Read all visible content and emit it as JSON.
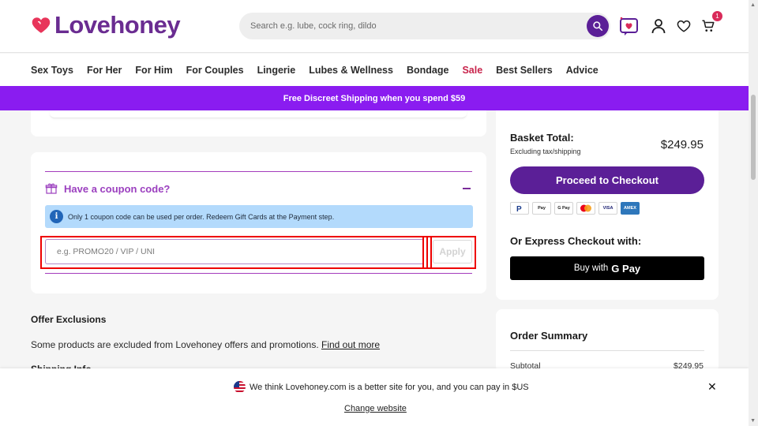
{
  "header": {
    "logo_text": "Lovehoney",
    "search_placeholder": "Search e.g. lube, cock ring, dildo",
    "cart_count": "1"
  },
  "nav": {
    "items": [
      "Sex Toys",
      "For Her",
      "For Him",
      "For Couples",
      "Lingerie",
      "Lubes & Wellness",
      "Bondage",
      "Sale",
      "Best Sellers",
      "Advice"
    ]
  },
  "promo": {
    "text": "Free Discreet Shipping when you spend $59"
  },
  "coupon": {
    "title": "Have a coupon code?",
    "info": "Only 1 coupon code can be used per order. Redeem Gift Cards at the Payment step.",
    "input_placeholder": "e.g. PROMO20 / VIP / UNI",
    "apply_label": "Apply"
  },
  "offers": {
    "title": "Offer Exclusions",
    "text": "Some products are excluded from Lovehoney offers and promotions. ",
    "link": "Find out more",
    "next_heading": "Shipping Info"
  },
  "basket": {
    "title": "Basket Total:",
    "subtitle": "Excluding tax/shipping",
    "total": "$249.95",
    "checkout_label": "Proceed to Checkout",
    "payment_methods": [
      "PayPal",
      "Pay",
      "G Pay",
      "Mastercard",
      "VISA",
      "AMEX"
    ],
    "express_title": "Or Express Checkout with:",
    "gpay_label": "Buy with",
    "gpay_brand": "G Pay"
  },
  "order_summary": {
    "title": "Order Summary",
    "subtotal_label": "Subtotal",
    "subtotal_value": "$249.95"
  },
  "banner": {
    "message": "We think Lovehoney.com is a better site for you, and you can pay in $US",
    "link": "Change website"
  },
  "colors": {
    "brand_purple": "#5b1f97",
    "promo_purple": "#8a1cf0",
    "sale_red": "#c8234b",
    "logo_heart": "#e8355a"
  }
}
